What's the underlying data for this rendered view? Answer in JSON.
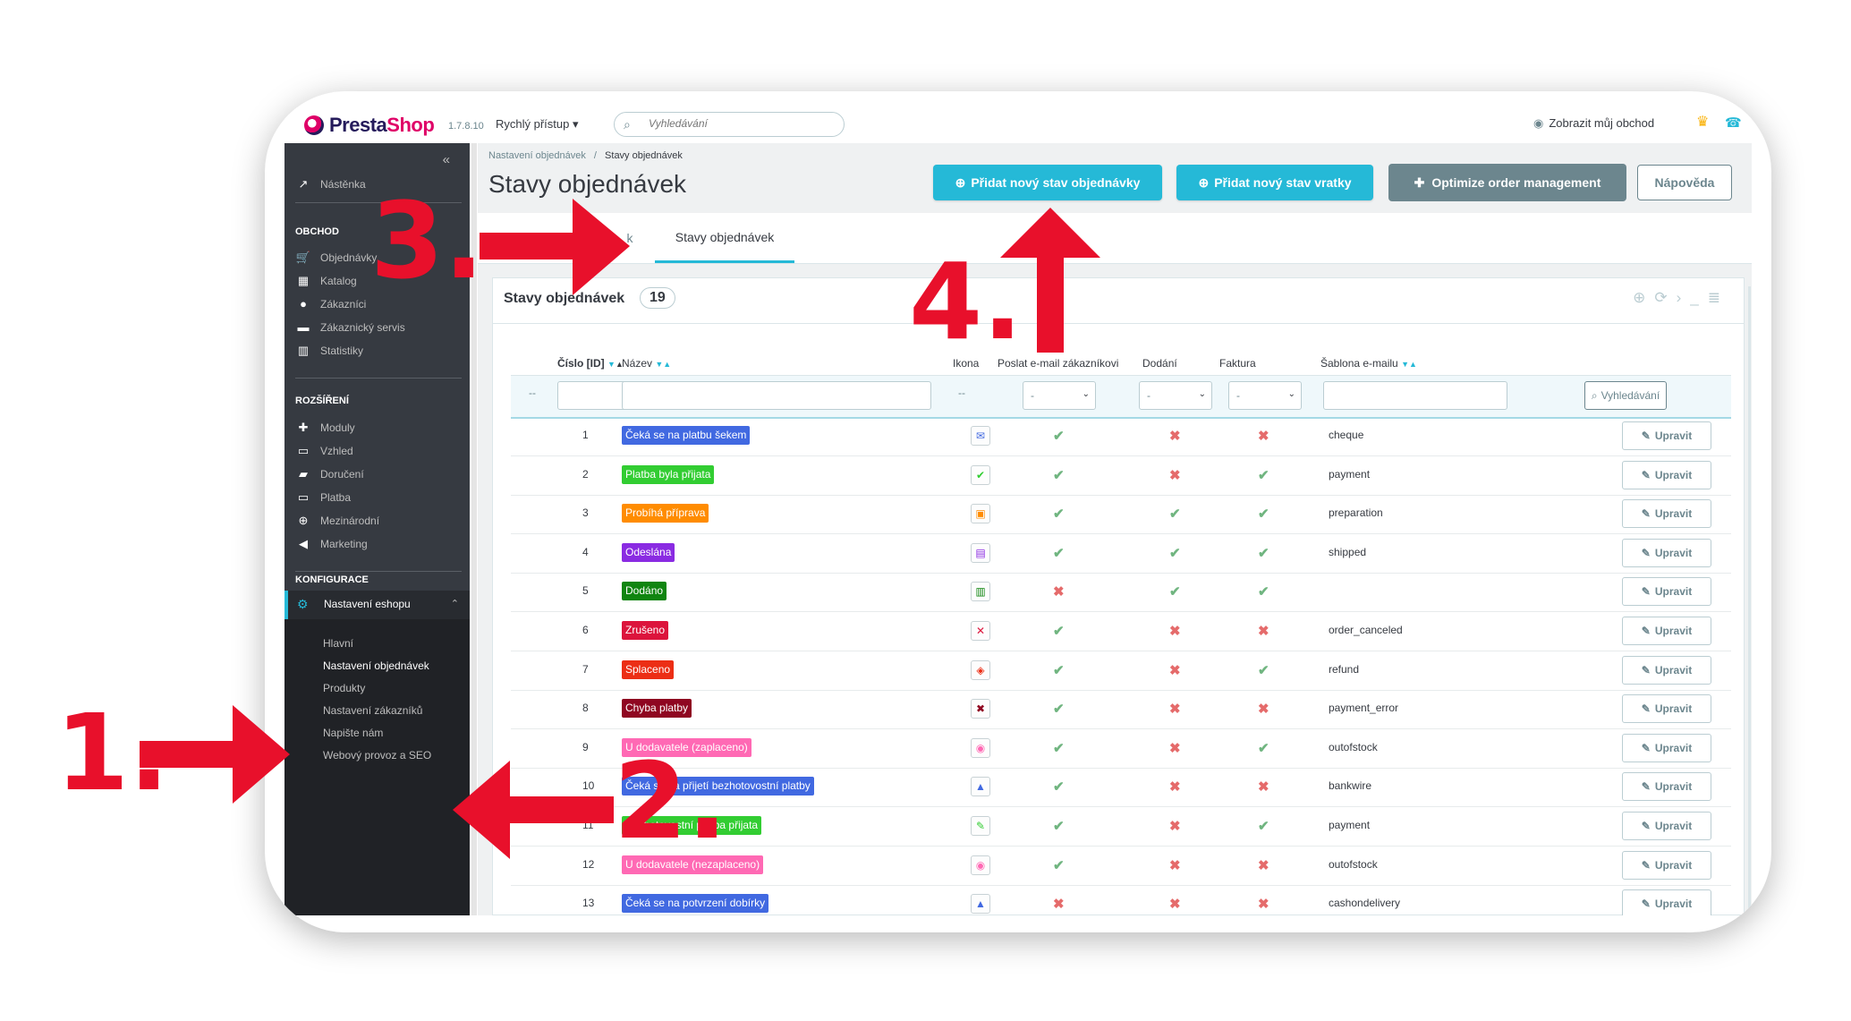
{
  "header": {
    "logo_name": "Presta",
    "logo_accent": "Shop",
    "version": "1.7.8.10",
    "quick_access": "Rychlý přístup ▾",
    "search_placeholder": "Vyhledávání",
    "view_shop": "Zobrazit můj obchod"
  },
  "sidebar": {
    "dashboard": "Nástěnka",
    "section_shop": "OBCHOD",
    "shop_items": [
      "Objednávky",
      "Katalog",
      "Zákazníci",
      "Zákaznický servis",
      "Statistiky"
    ],
    "section_ext": "ROZŠÍŘENÍ",
    "ext_items": [
      "Moduly",
      "Vzhled",
      "Doručení",
      "Platba",
      "Mezinárodní",
      "Marketing"
    ],
    "section_config": "KONFIGURACE",
    "active_item": "Nastavení eshopu",
    "submenu": [
      "Hlavní",
      "Nastavení objednávek",
      "Produkty",
      "Nastavení zákazníků",
      "Napište nám",
      "Webový provoz a SEO"
    ]
  },
  "breadcrumb": {
    "parent": "Nastavení objednávek",
    "separator": "/",
    "current": "Stavy objednávek"
  },
  "page_title": "Stavy objednávek",
  "toolbar": {
    "add_order_state": "Přidat nový stav objednávky",
    "add_return_state": "Přidat nový stav vratky",
    "optimize": "Optimize order management",
    "help": "Nápověda"
  },
  "tabs": {
    "hidden_tab_tail": "k",
    "active_tab": "Stavy objednávek"
  },
  "panel": {
    "title": "Stavy objednávek",
    "count": "19"
  },
  "table": {
    "headers": {
      "id": "Číslo [ID]",
      "name": "Název",
      "icon": "Ikona",
      "send_email": "Poslat e-mail zákazníkovi",
      "delivery": "Dodání",
      "invoice": "Faktura",
      "template": "Šablona e-mailu"
    },
    "filter": {
      "dash": "--",
      "select_value": "-",
      "search_button": "Vyhledávání"
    },
    "edit_label": "Upravit",
    "rows": [
      {
        "id": "1",
        "name": "Čeká se na platbu šekem",
        "color": "#4169e1",
        "icon": "cheque-icon",
        "glyph": "✉",
        "email": true,
        "delivery": false,
        "invoice": false,
        "template": "cheque"
      },
      {
        "id": "2",
        "name": "Platba byla přijata",
        "color": "#32cd32",
        "icon": "payment-ok-icon",
        "glyph": "✔",
        "email": true,
        "delivery": false,
        "invoice": true,
        "template": "payment"
      },
      {
        "id": "3",
        "name": "Probíhá příprava",
        "color": "#ff8c00",
        "icon": "package-icon",
        "glyph": "▣",
        "email": true,
        "delivery": true,
        "invoice": true,
        "template": "preparation"
      },
      {
        "id": "4",
        "name": "Odeslána",
        "color": "#8a2be2",
        "icon": "truck-icon",
        "glyph": "▤",
        "email": true,
        "delivery": true,
        "invoice": true,
        "template": "shipped"
      },
      {
        "id": "5",
        "name": "Dodáno",
        "color": "#108510",
        "icon": "delivered-icon",
        "glyph": "▥",
        "email": false,
        "delivery": true,
        "invoice": true,
        "template": ""
      },
      {
        "id": "6",
        "name": "Zrušeno",
        "color": "#dc143c",
        "icon": "cancel-icon",
        "glyph": "✕",
        "email": true,
        "delivery": false,
        "invoice": false,
        "template": "order_canceled"
      },
      {
        "id": "7",
        "name": "Splaceno",
        "color": "#ec2e15",
        "icon": "refund-icon",
        "glyph": "◈",
        "email": true,
        "delivery": false,
        "invoice": true,
        "template": "refund"
      },
      {
        "id": "8",
        "name": "Chyba platby",
        "color": "#8f0621",
        "icon": "error-icon",
        "glyph": "✖",
        "email": true,
        "delivery": false,
        "invoice": false,
        "template": "payment_error"
      },
      {
        "id": "9",
        "name": "U dodavatele (zaplaceno)",
        "color": "#ff69b4",
        "icon": "backorder-icon",
        "glyph": "◉",
        "email": true,
        "delivery": false,
        "invoice": true,
        "template": "outofstock"
      },
      {
        "id": "10",
        "name": "Čeká se na přijetí bezhotovostní platby",
        "color": "#4169e1",
        "icon": "bankwire-icon",
        "glyph": "▲",
        "email": true,
        "delivery": false,
        "invoice": false,
        "template": "bankwire"
      },
      {
        "id": "11",
        "name": "Bezhotovostní platba přijata",
        "color": "#32cd32",
        "icon": "remote-payment-icon",
        "glyph": "✎",
        "email": true,
        "delivery": false,
        "invoice": true,
        "template": "payment"
      },
      {
        "id": "12",
        "name": "U dodavatele (nezaplaceno)",
        "color": "#ff69b4",
        "icon": "backorder-unpaid-icon",
        "glyph": "◉",
        "email": true,
        "delivery": false,
        "invoice": false,
        "template": "outofstock"
      },
      {
        "id": "13",
        "name": "Čeká se na potvrzení dobírky",
        "color": "#4169e1",
        "icon": "cod-icon",
        "glyph": "▲",
        "email": false,
        "delivery": false,
        "invoice": false,
        "template": "cashondelivery"
      }
    ]
  },
  "annotations": {
    "step1": "1.",
    "step2": "2.",
    "step3": "3.",
    "step4": "4."
  },
  "colors": {
    "accent": "#25b9d7",
    "sidebar": "#363a41",
    "annotation": "#e8102b",
    "ok": "#70b580",
    "no": "#e56b6b",
    "brand_pink": "#df0067"
  }
}
